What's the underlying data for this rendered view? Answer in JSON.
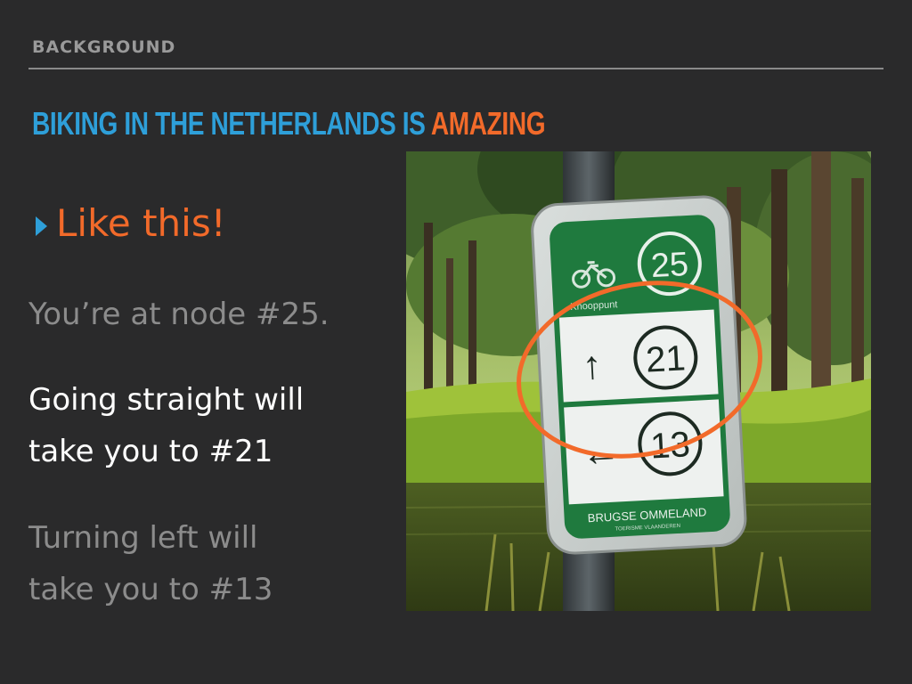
{
  "slide": {
    "section_label": "BACKGROUND",
    "title_part1": "BIKING IN THE NETHERLANDS IS ",
    "title_part2": "AMAZING",
    "bullet": "Like this!",
    "node_line": "You’re at node #25.",
    "straight_line1": "Going straight will",
    "straight_line2": "take you to #21",
    "left_line1": "Turning left will",
    "left_line2": "take you to #13"
  },
  "sign": {
    "node_number": "25",
    "knooppunt": "Knooppunt",
    "straight_node": "21",
    "left_node": "13",
    "footer": "BRUGSE OMMELAND",
    "footer_small": "TOERISME VLAANDEREN"
  },
  "colors": {
    "background": "#2a2a2b",
    "accent_blue": "#2e9fd9",
    "accent_orange": "#f26a2a",
    "sign_green": "#1f7a3e"
  }
}
